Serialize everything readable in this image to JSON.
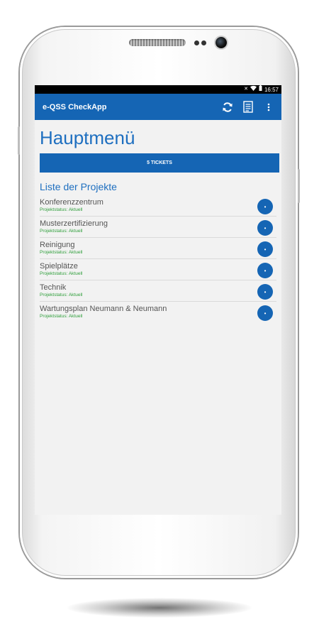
{
  "status_bar": {
    "time": "16:57",
    "icons": [
      "notification-icon",
      "wifi-icon",
      "battery-icon"
    ]
  },
  "app_bar": {
    "title": "e-QSS CheckApp",
    "actions": [
      "refresh-icon",
      "document-icon",
      "more-vert-icon"
    ]
  },
  "main": {
    "title": "Hauptmenü",
    "tickets_button": "5 TICKETS",
    "section_title": "Liste der Projekte",
    "projects": [
      {
        "name": "Konferenzzentrum",
        "status": "Projektstatus: Aktuell"
      },
      {
        "name": "Musterzertifizierung",
        "status": "Projektstatus: Aktuell"
      },
      {
        "name": "Reinigung",
        "status": "Projektstatus: Aktuell"
      },
      {
        "name": "Spielplätze",
        "status": "Projektstatus: Aktuell"
      },
      {
        "name": "Technik",
        "status": "Projektstatus: Aktuell"
      },
      {
        "name": "Wartungsplan Neumann & Neumann",
        "status": "Projektstatus: Aktuell"
      }
    ]
  },
  "colors": {
    "primary": "#1565b4",
    "title_blue": "#1e6fc0",
    "status_green": "#2e9e3a",
    "background": "#f2f2f2"
  }
}
